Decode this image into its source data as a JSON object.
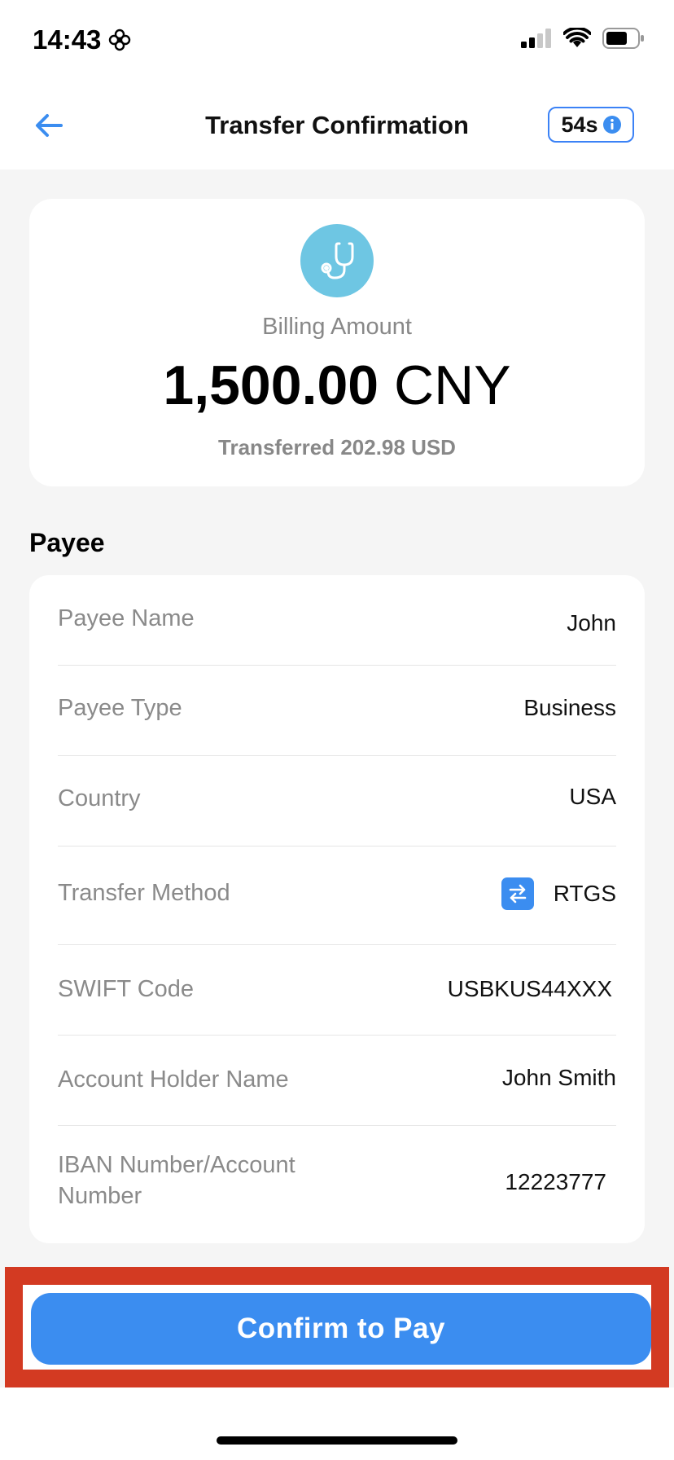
{
  "status_bar": {
    "time": "14:43"
  },
  "header": {
    "title": "Transfer Confirmation",
    "timer": "54s"
  },
  "amount_card": {
    "billing_label": "Billing Amount",
    "amount": "1,500.00",
    "currency": "CNY",
    "transferred": "Transferred 202.98 USD"
  },
  "payee": {
    "section_title": "Payee",
    "rows": [
      {
        "label": "Payee Name",
        "value": "John"
      },
      {
        "label": "Payee Type",
        "value": "Business"
      },
      {
        "label": "Country",
        "value": "USA"
      },
      {
        "label": "Transfer Method",
        "value": "RTGS"
      },
      {
        "label": "SWIFT Code",
        "value": "USBKUS44XXX"
      },
      {
        "label": "Account Holder Name",
        "value": "John Smith"
      },
      {
        "label": "IBAN Number/Account Number",
        "value": "12223777"
      }
    ]
  },
  "confirm_button": {
    "label": "Confirm to Pay"
  },
  "colors": {
    "accent": "#3b8df0",
    "highlight_frame": "#d33a22",
    "icon_bg": "#6ec6e3"
  }
}
